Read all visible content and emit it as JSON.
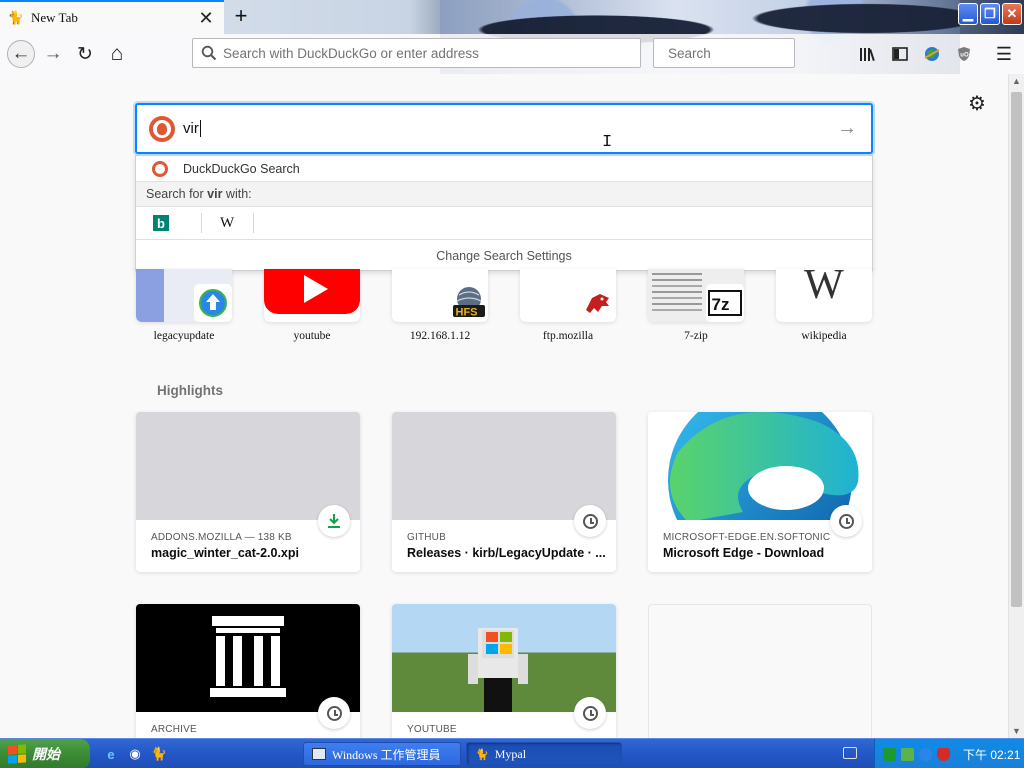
{
  "tab": {
    "title": "New Tab",
    "close": "✕",
    "new": "+"
  },
  "toolbar": {
    "back": "←",
    "forward": "→",
    "reload": "↻",
    "home": "⌂",
    "url_placeholder": "Search with DuckDuckGo or enter address",
    "search_placeholder": "Search",
    "menu": "☰"
  },
  "window": {
    "minimize": "▁",
    "restore": "❐",
    "close": "✕"
  },
  "newtab": {
    "gear": "⚙",
    "search_query": "vir",
    "dropdown": {
      "engine_label": "DuckDuckGo Search",
      "search_for_prefix": "Search for ",
      "search_for_term": "vir",
      "search_for_suffix": " with:",
      "engines": [
        "Bing",
        "Wikipedia"
      ],
      "bing_glyph": "b",
      "wiki_glyph": "W",
      "settings": "Change Search Settings"
    },
    "top_sites": [
      {
        "label": "legacyupdate"
      },
      {
        "label": "youtube"
      },
      {
        "label": "192.168.1.12",
        "badge": "HFS"
      },
      {
        "label": "ftp.mozilla"
      },
      {
        "label": "7-zip",
        "badge": "7z"
      },
      {
        "label": "wikipedia",
        "badge": "W"
      }
    ],
    "highlights_title": "Highlights",
    "highlights": [
      {
        "host": "ADDONS.MOZILLA — 138 KB",
        "title": "magic_winter_cat-2.0.xpi",
        "type": "download"
      },
      {
        "host": "GITHUB",
        "title": "Releases · kirb/LegacyUpdate · ...",
        "type": "history"
      },
      {
        "host": "MICROSOFT-EDGE.EN.SOFTONIC",
        "title": "Microsoft Edge - Download",
        "type": "history"
      },
      {
        "host": "ARCHIVE",
        "title": "",
        "type": "history"
      },
      {
        "host": "YOUTUBE",
        "title": "",
        "type": "history"
      }
    ]
  },
  "taskbar": {
    "start": "開始",
    "tasks": [
      "Windows 工作管理員",
      "Mypal"
    ],
    "clock": "下午 02:21"
  },
  "colors": {
    "accent": "#0a84ff",
    "ddg": "#de5833",
    "bing": "#008373",
    "taskbar": "#2457c7",
    "start": "#3c8b35"
  }
}
